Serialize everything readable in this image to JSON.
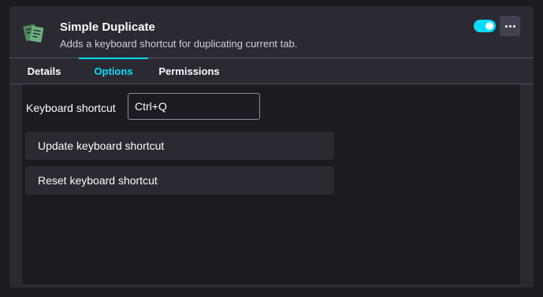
{
  "addon": {
    "name": "Simple Duplicate",
    "description": "Adds a keyboard shortcut for duplicating current tab.",
    "icon": "duplicate-pages-icon",
    "enabled": true
  },
  "tabs": [
    {
      "label": "Details",
      "active": false
    },
    {
      "label": "Options",
      "active": true
    },
    {
      "label": "Permissions",
      "active": false
    }
  ],
  "options": {
    "shortcut_label": "Keyboard shortcut",
    "shortcut_value": "Ctrl+Q",
    "update_button": "Update keyboard shortcut",
    "reset_button": "Reset keyboard shortcut"
  },
  "colors": {
    "accent": "#00ddff",
    "background": "#1c1b22",
    "card": "#2b2a33",
    "icon_green": "#5a9e6f"
  }
}
